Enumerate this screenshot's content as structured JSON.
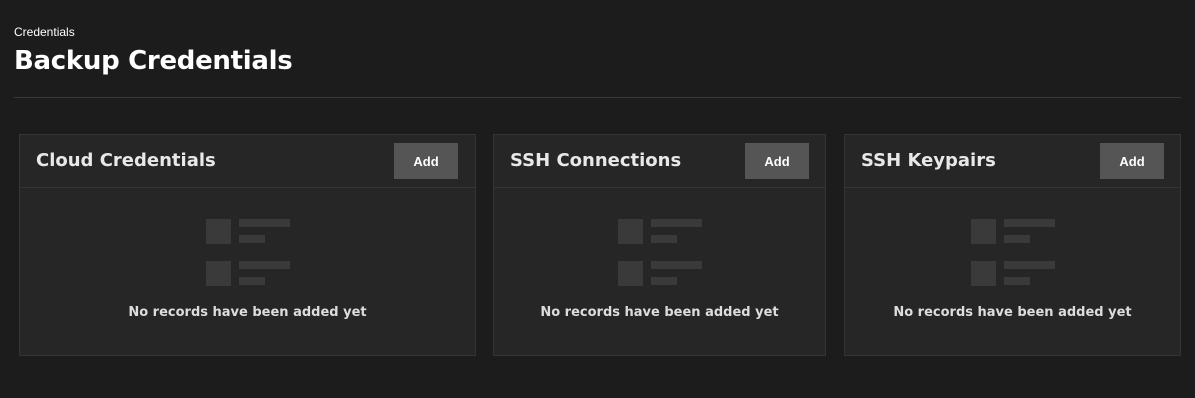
{
  "header": {
    "breadcrumb": "Credentials",
    "title": "Backup Credentials"
  },
  "cards": [
    {
      "title": "Cloud Credentials",
      "add_label": "Add",
      "empty_text": "No records have been added yet"
    },
    {
      "title": "SSH Connections",
      "add_label": "Add",
      "empty_text": "No records have been added yet"
    },
    {
      "title": "SSH Keypairs",
      "add_label": "Add",
      "empty_text": "No records have been added yet"
    }
  ],
  "colors": {
    "background": "#1c1c1c",
    "card_background": "#262626",
    "button_background": "#555555",
    "placeholder": "#3a3a3a"
  }
}
